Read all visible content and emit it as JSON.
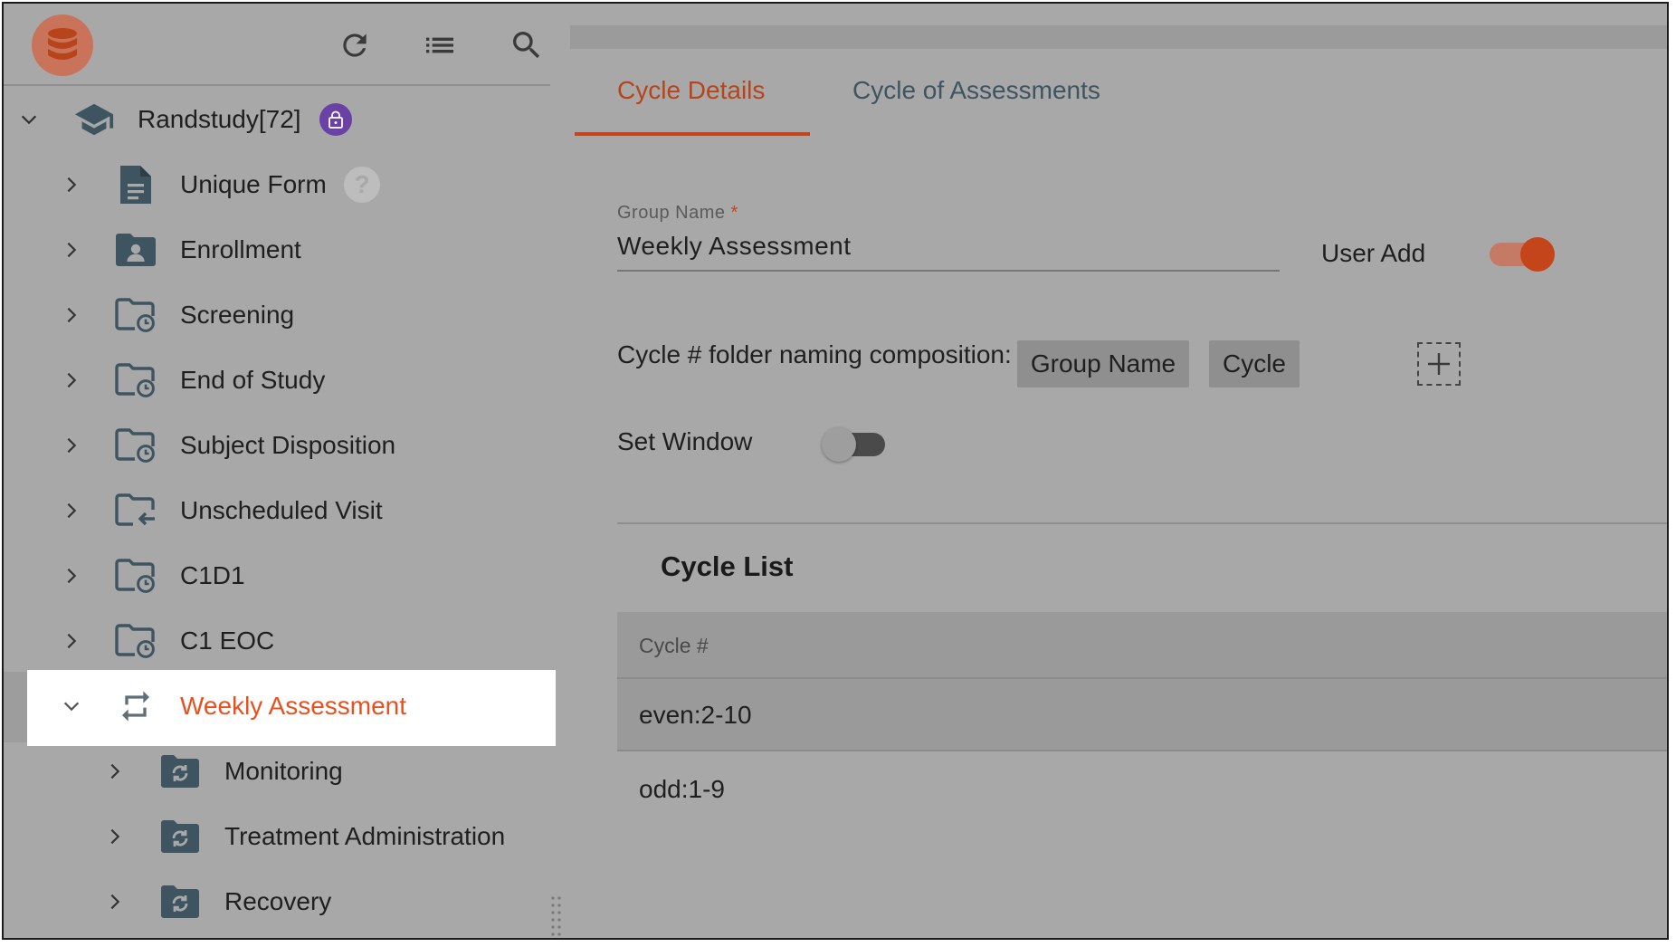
{
  "sidebar": {
    "toolbar": {
      "logo_icon": "database-icon",
      "refresh_icon": "refresh-icon",
      "list_icon": "list-icon",
      "search_icon": "search-icon"
    },
    "root": {
      "label": "Randstudy[72]",
      "icon": "graduation-cap-icon",
      "badge_icon": "lock-icon",
      "expanded": true
    },
    "items": [
      {
        "label": "Unique Form",
        "icon": "document-icon",
        "badge": "?"
      },
      {
        "label": "Enrollment",
        "icon": "folder-user-icon"
      },
      {
        "label": "Screening",
        "icon": "folder-clock-icon"
      },
      {
        "label": "End of Study",
        "icon": "folder-clock-icon"
      },
      {
        "label": "Subject Disposition",
        "icon": "folder-clock-icon"
      },
      {
        "label": "Unscheduled Visit",
        "icon": "folder-arrow-icon"
      },
      {
        "label": "C1D1",
        "icon": "folder-clock-icon"
      },
      {
        "label": "C1 EOC",
        "icon": "folder-clock-icon"
      },
      {
        "label": "Weekly Assessment",
        "icon": "repeat-icon",
        "selected": true,
        "expanded": true
      }
    ],
    "children": [
      {
        "label": "Monitoring",
        "icon": "cycle-folder-icon"
      },
      {
        "label": "Treatment Administration",
        "icon": "cycle-folder-icon"
      },
      {
        "label": "Recovery",
        "icon": "cycle-folder-icon"
      }
    ]
  },
  "main": {
    "tabs": [
      {
        "label": "Cycle Details",
        "active": true
      },
      {
        "label": "Cycle of Assessments",
        "active": false
      }
    ],
    "group_name": {
      "label": "Group Name",
      "required_mark": "*",
      "value": "Weekly Assessment"
    },
    "user_add": {
      "label": "User Add",
      "enabled": true
    },
    "composition": {
      "label": "Cycle # folder naming composition:",
      "chips": [
        "Group Name",
        "Cycle"
      ]
    },
    "set_window": {
      "label": "Set Window",
      "enabled": false
    },
    "cycle_list": {
      "title": "Cycle List",
      "column": "Cycle #",
      "rows": [
        "even:2-10",
        "odd:1-9"
      ]
    }
  },
  "colors": {
    "accent": "#c4451a",
    "selected_text": "#e8511f",
    "lock_badge": "#6a42a6",
    "inactive_tab": "#3e5561"
  }
}
